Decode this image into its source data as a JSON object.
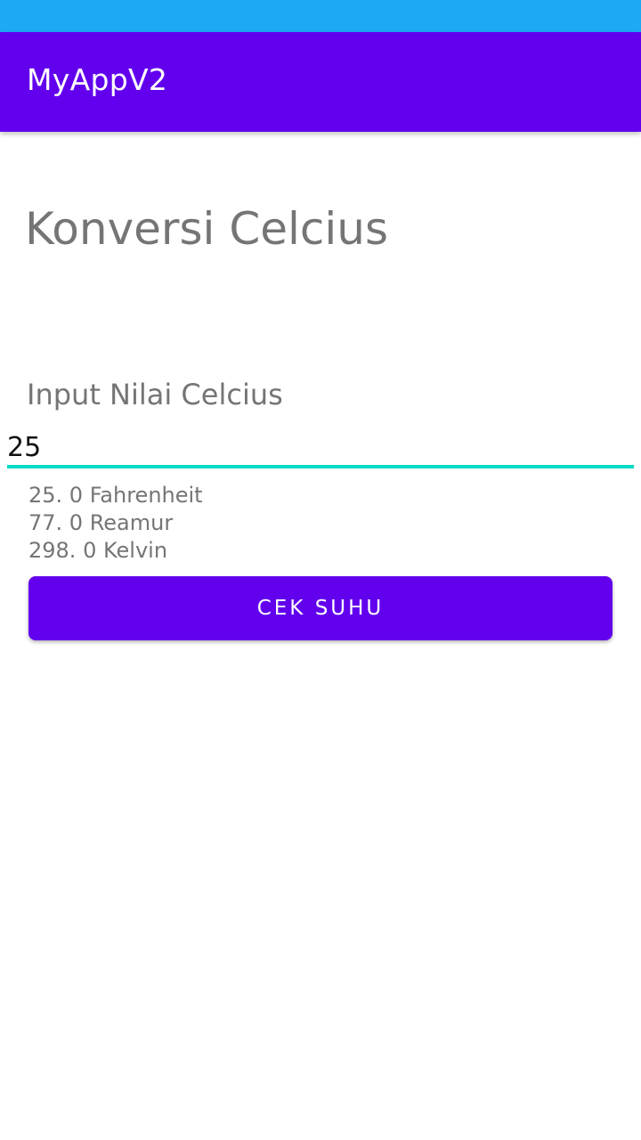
{
  "colors": {
    "status_bar": "#1daaf3",
    "primary": "#6200ee",
    "accent": "#03dac5",
    "secondary_text": "#757575"
  },
  "app_bar": {
    "title": "MyAppV2"
  },
  "main": {
    "title": "Konversi Celcius",
    "input_label": "Input Nilai Celcius",
    "input_value": "25",
    "results": [
      "25. 0 Fahrenheit",
      "77. 0 Reamur",
      "298. 0 Kelvin"
    ],
    "button_label": "CEK SUHU"
  }
}
